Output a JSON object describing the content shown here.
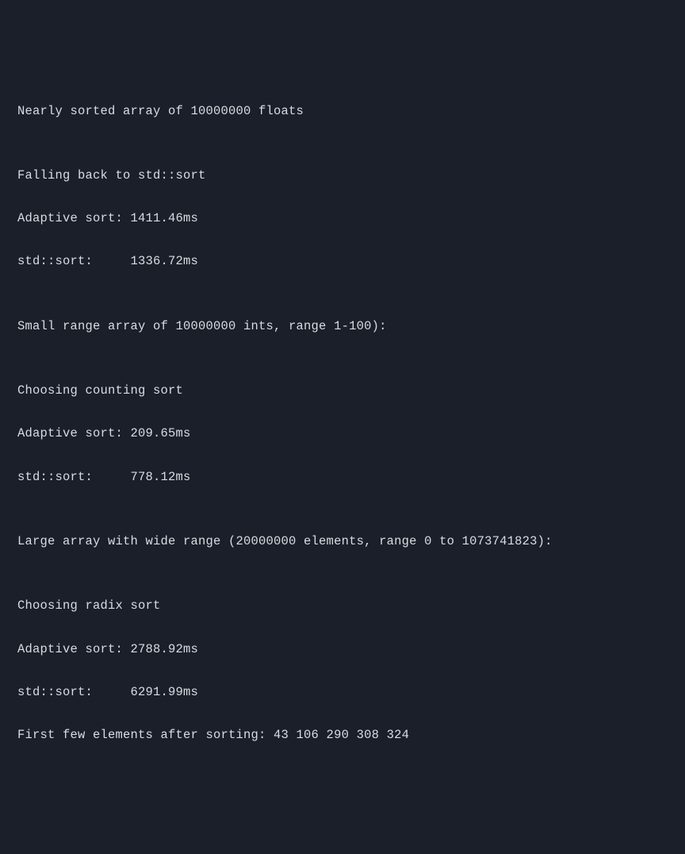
{
  "lines": {
    "l0": "Nearly sorted array of 10000000 floats",
    "l1": "",
    "l2": "Falling back to std::sort",
    "l3": "Adaptive sort: 1411.46ms",
    "l4": "std::sort:     1336.72ms",
    "l5": "",
    "l6": "Small range array of 10000000 ints, range 1-100):",
    "l7": "",
    "l8": "Choosing counting sort",
    "l9": "Adaptive sort: 209.65ms",
    "l10": "std::sort:     778.12ms",
    "l11": "",
    "l12": "Large array with wide range (20000000 elements, range 0 to 1073741823):",
    "l13": "",
    "l14": "Choosing radix sort",
    "l15": "Adaptive sort: 2788.92ms",
    "l16": "std::sort:     6291.99ms",
    "l17": "First few elements after sorting: 43 106 290 308 324"
  }
}
